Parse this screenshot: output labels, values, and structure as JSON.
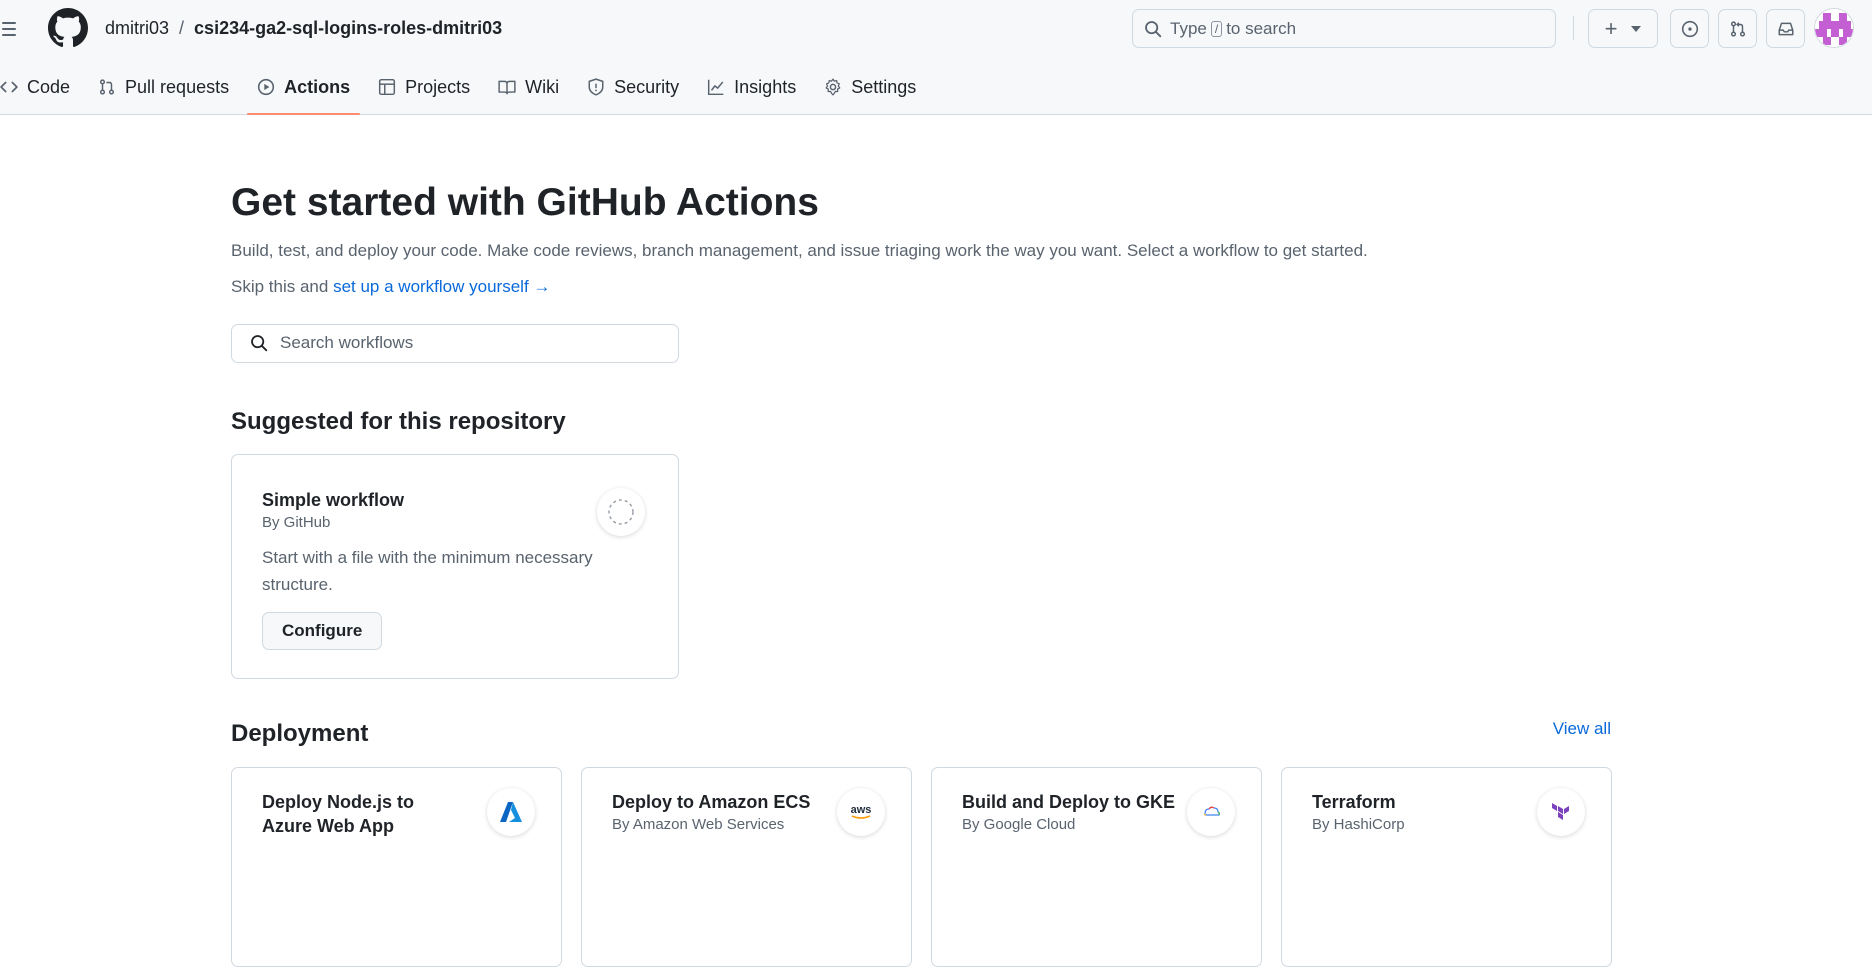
{
  "header": {
    "owner": "dmitri03",
    "separator": "/",
    "repo": "csi234-ga2-sql-logins-roles-dmitri03",
    "search_prefix": "Type",
    "search_key": "/",
    "search_suffix": "to search",
    "new_button_plus": "+"
  },
  "tabs": [
    {
      "label": "Code",
      "icon": "code-icon"
    },
    {
      "label": "Pull requests",
      "icon": "git-pull-request-icon"
    },
    {
      "label": "Actions",
      "icon": "play-icon",
      "active": true
    },
    {
      "label": "Projects",
      "icon": "table-icon"
    },
    {
      "label": "Wiki",
      "icon": "book-icon"
    },
    {
      "label": "Security",
      "icon": "shield-icon"
    },
    {
      "label": "Insights",
      "icon": "graph-icon"
    },
    {
      "label": "Settings",
      "icon": "gear-icon"
    }
  ],
  "main": {
    "title": "Get started with GitHub Actions",
    "lead": "Build, test, and deploy your code. Make code reviews, branch management, and issue triaging work the way you want. Select a workflow to get started.",
    "skip_prefix": "Skip this and",
    "skip_link": "set up a workflow yourself",
    "skip_arrow": "→",
    "search_placeholder": "Search workflows"
  },
  "suggested": {
    "heading": "Suggested for this repository",
    "card": {
      "title": "Simple workflow",
      "by": "By GitHub",
      "description": "Start with a file with the minimum necessary structure.",
      "button": "Configure"
    }
  },
  "deployment": {
    "heading": "Deployment",
    "view_all": "View all",
    "cards": [
      {
        "title": "Deploy Node.js to Azure Web App",
        "by": "",
        "logo": "azure-logo"
      },
      {
        "title": "Deploy to Amazon ECS",
        "by": "By Amazon Web Services",
        "logo": "aws-logo"
      },
      {
        "title": "Build and Deploy to GKE",
        "by": "By Google Cloud",
        "logo": "google-cloud-logo"
      },
      {
        "title": "Terraform",
        "by": "By HashiCorp",
        "logo": "terraform-logo"
      }
    ]
  },
  "colors": {
    "accent_underline": "#fd8c73",
    "link": "#0969da",
    "text_primary": "#1f2328",
    "text_muted": "#59636e",
    "border": "#d1d9e0",
    "header_bg": "#f6f8fa"
  }
}
